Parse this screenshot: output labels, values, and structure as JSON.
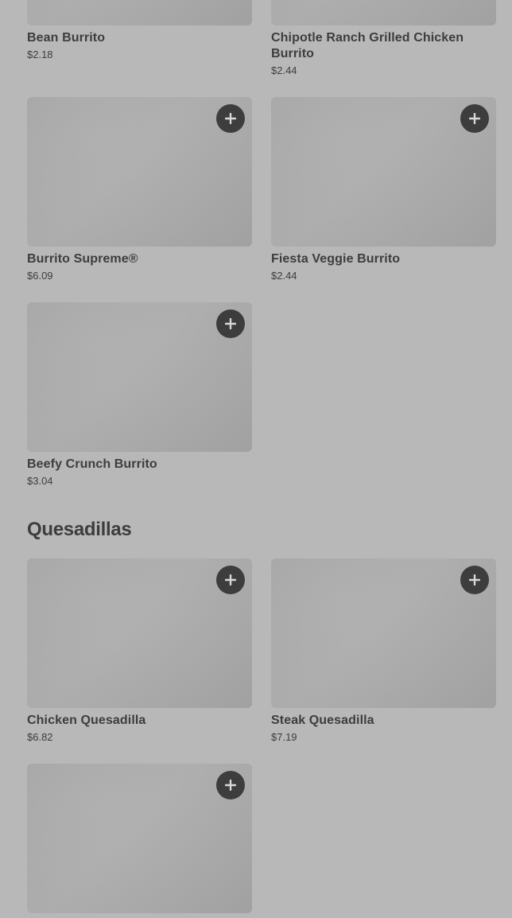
{
  "burritos": [
    {
      "name": "Bean Burrito",
      "price": "$2.18"
    },
    {
      "name": "Chipotle Ranch Grilled Chicken Burrito",
      "price": "$2.44"
    },
    {
      "name": "Burrito Supreme®",
      "price": "$6.09"
    },
    {
      "name": "Fiesta Veggie Burrito",
      "price": "$2.44"
    },
    {
      "name": "Beefy Crunch Burrito",
      "price": "$3.04"
    }
  ],
  "quesadillas_section": {
    "title": "Quesadillas"
  },
  "quesadillas": [
    {
      "name": "Chicken Quesadilla",
      "price": "$6.82"
    },
    {
      "name": "Steak Quesadilla",
      "price": "$7.19"
    },
    {
      "name": "",
      "price": ""
    }
  ],
  "add_button_icon": "plus-icon"
}
